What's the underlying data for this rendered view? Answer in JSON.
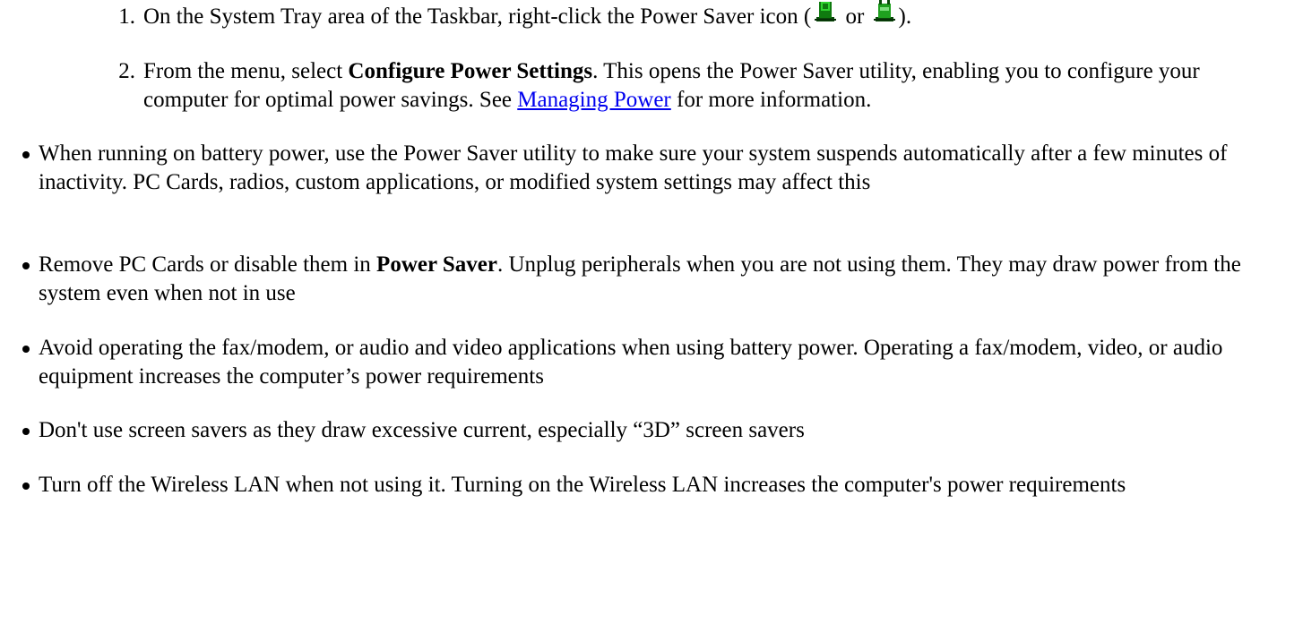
{
  "steps": [
    {
      "number": "1.",
      "text_before": "On the System Tray area of the Taskbar, right-click the Power Saver icon ",
      "paren_open": "(",
      "icon_1": "power-saver-ac-icon",
      "or_text": " or ",
      "icon_2": "power-saver-battery-icon",
      "paren_close": ")."
    },
    {
      "number": "2.",
      "text_before": "From the menu, select ",
      "bold": "Configure Power Settings",
      "text_after": ". This opens the Power Saver utility, enabling you to configure your computer for optimal power savings. See ",
      "link": "Managing Power",
      "text_end": " for more information."
    }
  ],
  "bullets": [
    {
      "text": "When running on battery power, use the Power Saver utility to make sure your system suspends automatically after a few minutes of inactivity. PC Cards, radios, custom applications, or modified system settings may affect this"
    },
    {
      "text_before": "Remove PC Cards or disable them in ",
      "bold": "Power Saver",
      "text_after": ". Unplug peripherals when you are not using them. They may draw power from the system even when not in use"
    },
    {
      "text": "Avoid operating the fax/modem, or audio and video applications when using battery power. Operating a fax/modem, video, or audio equipment increases the computer’s power requirements"
    },
    {
      "text": "Don't use screen savers as they draw excessive current, especially “3D” screen savers"
    },
    {
      "text": "Turn off the Wireless LAN when not using it. Turning on the Wireless LAN increases the computer's power requirements"
    }
  ],
  "colors": {
    "text": "#000000",
    "link": "#0000ee",
    "icon_green": "#1fa01f",
    "icon_dark": "#0a4a0a"
  }
}
